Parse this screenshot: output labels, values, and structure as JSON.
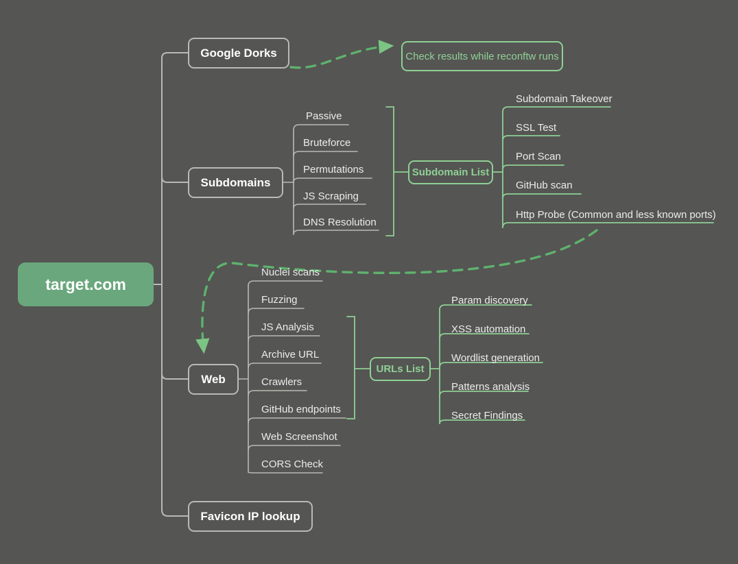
{
  "diagram": {
    "title": "reconftw recon workflow mindmap",
    "background_color": "#555553",
    "accent_green": "#8fd095",
    "root_fill": "#6aa77d",
    "line_gray": "#b9b9b5",
    "text_light": "#ececec"
  },
  "root": {
    "label": "target.com"
  },
  "branches": [
    {
      "label": "Google Dorks"
    },
    {
      "label": "Subdomains"
    },
    {
      "label": "Web"
    },
    {
      "label": "Favicon IP lookup"
    }
  ],
  "notes": [
    {
      "label": "Check results while reconftw runs"
    }
  ],
  "subdomains": {
    "label": "Subdomains",
    "children": [
      {
        "label": "Passive"
      },
      {
        "label": "Bruteforce"
      },
      {
        "label": "Permutations"
      },
      {
        "label": "JS Scraping"
      },
      {
        "label": "DNS Resolution"
      }
    ],
    "output": {
      "label": "Subdomain List"
    },
    "output_children": [
      {
        "label": "Subdomain Takeover"
      },
      {
        "label": "SSL Test"
      },
      {
        "label": "Port Scan"
      },
      {
        "label": "GitHub scan"
      },
      {
        "label": "Http Probe (Common and less known ports)"
      }
    ]
  },
  "web": {
    "label": "Web",
    "children": [
      {
        "label": "Nuclei scans"
      },
      {
        "label": "Fuzzing"
      },
      {
        "label": "JS Analysis"
      },
      {
        "label": "Archive URL"
      },
      {
        "label": "Crawlers"
      },
      {
        "label": "GitHub endpoints"
      },
      {
        "label": "Web Screenshot"
      },
      {
        "label": "CORS Check"
      }
    ],
    "output": {
      "label": "URLs List"
    },
    "output_children": [
      {
        "label": "Param discovery"
      },
      {
        "label": "XSS automation"
      },
      {
        "label": "Wordlist generation"
      },
      {
        "label": "Patterns analysis"
      },
      {
        "label": "Secret Findings"
      }
    ]
  },
  "favicon": {
    "label": "Favicon IP lookup"
  }
}
